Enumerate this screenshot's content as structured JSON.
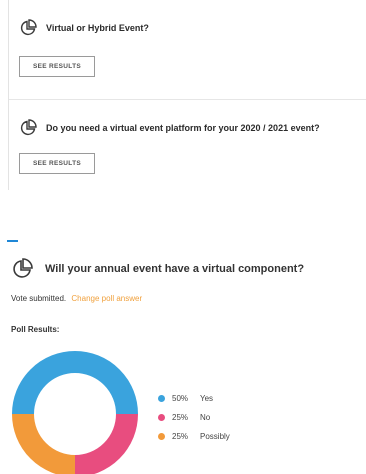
{
  "polls": [
    {
      "title": "Virtual or Hybrid Event?",
      "button_label": "SEE RESULTS"
    },
    {
      "title": "Do you need a virtual event platform for your 2020 / 2021 event?",
      "button_label": "SEE RESULTS"
    }
  ],
  "active_poll": {
    "title": "Will your annual event have a virtual component?",
    "vote_status": "Vote submitted.",
    "change_link": "Change poll answer",
    "results_label": "Poll Results:"
  },
  "colors": {
    "yes": "#3aa3dd",
    "no": "#e84d7f",
    "possibly": "#f29a3a",
    "link": "#f0a03c"
  },
  "icons": {
    "poll": "pie-chart-icon"
  },
  "chart_data": {
    "type": "pie",
    "style": "donut",
    "categories": [
      "Yes",
      "No",
      "Possibly"
    ],
    "values": [
      50,
      25,
      25
    ],
    "labels": [
      "50%",
      "25%",
      "25%"
    ],
    "legend_position": "right"
  }
}
